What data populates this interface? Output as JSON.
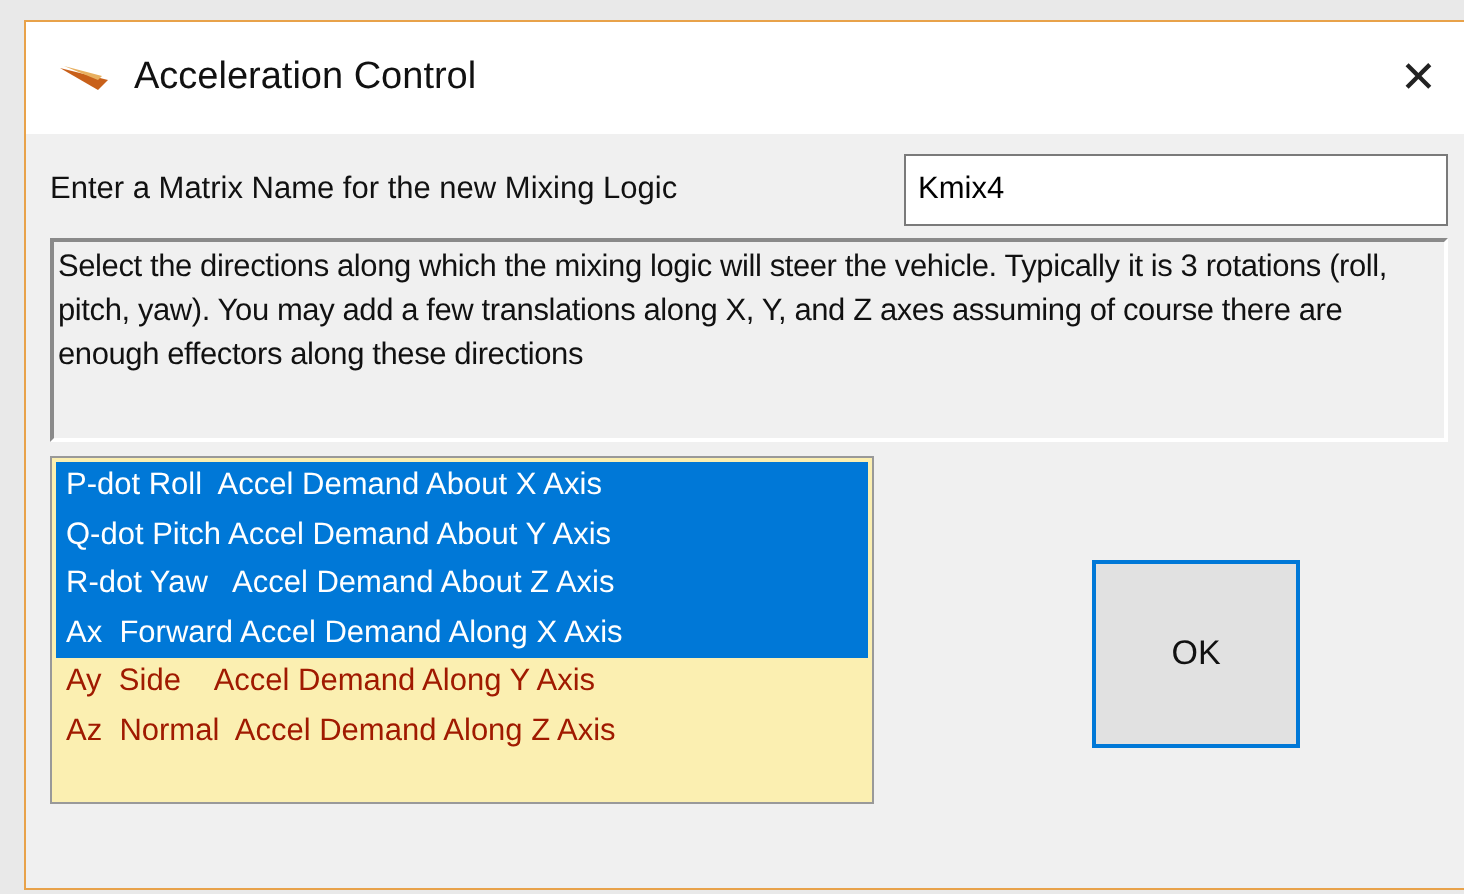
{
  "window": {
    "title": "Acceleration Control",
    "close": "✕"
  },
  "matrix_name": {
    "label": "Enter a Matrix Name for the new Mixing Logic",
    "value": "Kmix4"
  },
  "description": "Select the directions along which the mixing logic will steer the vehicle. Typically it is 3 rotations (roll, pitch,  yaw). You may add a few translations along X, Y, and Z axes assuming of course there are enough effectors along these directions",
  "directions": [
    {
      "label": "P-dot Roll  Accel Demand About X Axis",
      "selected": true
    },
    {
      "label": "Q-dot Pitch Accel Demand About Y Axis",
      "selected": true
    },
    {
      "label": "R-dot Yaw   Accel Demand About Z Axis",
      "selected": true
    },
    {
      "label": "Ax  Forward Accel Demand Along X Axis",
      "selected": true
    },
    {
      "label": "Ay  Side    Accel Demand Along Y Axis",
      "selected": false
    },
    {
      "label": "Az  Normal  Accel Demand Along Z Axis",
      "selected": false
    }
  ],
  "buttons": [
    "OK"
  ]
}
